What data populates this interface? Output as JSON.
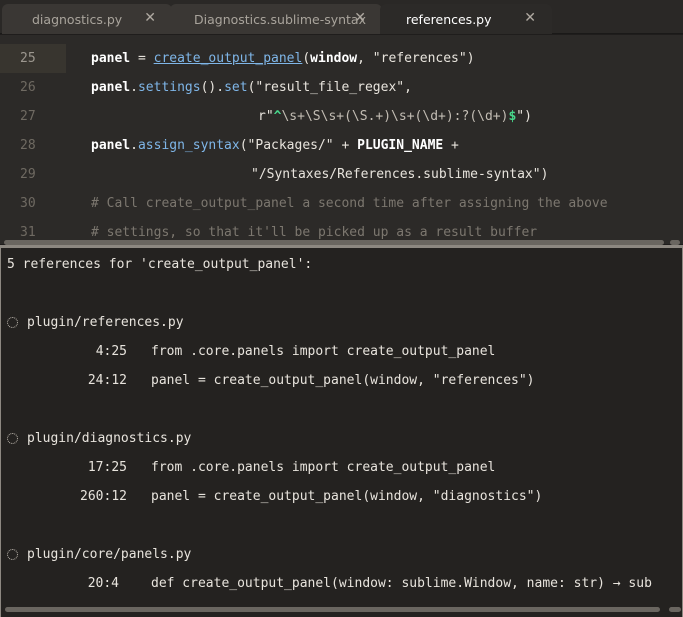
{
  "tabs": [
    {
      "label": "diagnostics.py",
      "active": false
    },
    {
      "label": "Diagnostics.sublime-syntax",
      "active": false
    },
    {
      "label": "references.py",
      "active": true
    }
  ],
  "tab_close_glyph": "✕",
  "editor": {
    "lines": [
      {
        "num": "25",
        "current": true
      },
      {
        "num": "26",
        "current": false
      },
      {
        "num": "27",
        "current": false
      },
      {
        "num": "28",
        "current": false
      },
      {
        "num": "29",
        "current": false
      },
      {
        "num": "30",
        "current": false
      },
      {
        "num": "31",
        "current": false
      }
    ],
    "code": {
      "l25_panel": "panel",
      "l25_eq": " = ",
      "l25_fn": "create_output_panel",
      "l25_paren": "(",
      "l25_window": "window",
      "l25_rest": ", \"references\")",
      "l26_panel": "panel",
      "l26_dot": ".",
      "l26_settings": "settings",
      "l26_mid": "().",
      "l26_set": "set",
      "l26_rest": "(\"result_file_regex\",",
      "l27_r": "r\"",
      "l27_caret": "^",
      "l27_regex": "\\s+\\S\\s+(\\S.+)\\s+(\\d+):?(\\d+)",
      "l27_dollar": "$",
      "l27_end": "\")",
      "l28_panel": "panel",
      "l28_dot": ".",
      "l28_fn": "assign_syntax",
      "l28_mid": "(\"Packages/\" + ",
      "l28_const": "PLUGIN_NAME",
      "l28_end": " +",
      "l29_str": "\"/Syntaxes/References.sublime-syntax\")",
      "l30_comment": "# Call create_output_panel a second time after assigning the above",
      "l31_comment": "# settings, so that it'll be picked up as a result buffer"
    }
  },
  "panel": {
    "header": "5 references for 'create_output_panel':",
    "groups": [
      {
        "file": "plugin/references.py",
        "refs": [
          {
            "pos": "4:25",
            "code": "from .core.panels import create_output_panel"
          },
          {
            "pos": "24:12",
            "code": "panel = create_output_panel(window, \"references\")"
          }
        ]
      },
      {
        "file": "plugin/diagnostics.py",
        "refs": [
          {
            "pos": "17:25",
            "code": "from .core.panels import create_output_panel"
          },
          {
            "pos": "260:12",
            "code": "panel = create_output_panel(window, \"diagnostics\")"
          }
        ]
      },
      {
        "file": "plugin/core/panels.py",
        "refs": [
          {
            "pos": "20:4",
            "code": "def create_output_panel(window: sublime.Window, name: str) → sub"
          }
        ]
      }
    ]
  },
  "colors": {
    "editor_bg": "#2c2a28",
    "panel_bg": "#242220",
    "function": "#7fb6e8",
    "regex_anchor": "#47d68b",
    "comment": "#7c776f"
  }
}
